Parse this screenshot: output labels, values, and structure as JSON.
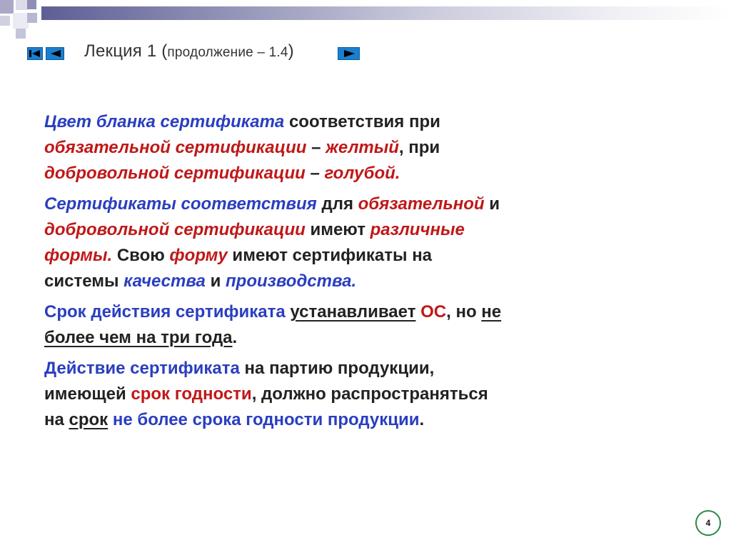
{
  "title": {
    "main": "Лекция 1 (",
    "sub": "продолжение – 1.4",
    "close": ")"
  },
  "nav": {
    "first_icon": "first-slide-icon",
    "prev_icon": "prev-slide-icon",
    "next_icon": "next-slide-icon"
  },
  "p1": {
    "a": "Цвет бланка сертификата",
    "b": " соответствия при",
    "c": "обязательной сертификации",
    "d": " – ",
    "e": "желтый",
    "f": ", при",
    "g": "добровольной сертификации",
    "h": " – ",
    "i": "голубой."
  },
  "p2": {
    "a": "Сертификаты соответствия",
    "b": " для ",
    "c": "обязательной",
    "d": " и",
    "e": "добровольной сертификации",
    "f": " имеют ",
    "g": "различные",
    "h": "формы.",
    "i": " Свою ",
    "j": "форму",
    "k": " имеют сертификаты на",
    "l": "системы ",
    "m": "качества",
    "n": " и ",
    "o": "производства."
  },
  "p3": {
    "a": "Срок действия сертификата",
    "b": " ",
    "c": "устанавливает",
    "d": " ",
    "e": "ОС",
    "f": ", но ",
    "g": "не",
    "h": "более чем на три года",
    "i": "."
  },
  "p4": {
    "a": "Действие сертификата",
    "b": " на партию продукции,",
    "c": "имеющей ",
    "d": "срок годности",
    "e": ", должно распространяться",
    "f": "на ",
    "g": "срок",
    "h": " ",
    "i": "не более срока годности продукции",
    "j": "."
  },
  "page_number": "4",
  "colors": {
    "blue": "#2a3ec0",
    "red": "#c01818",
    "nav": "#1a7fd1",
    "badge_border": "#2a8a4a"
  }
}
